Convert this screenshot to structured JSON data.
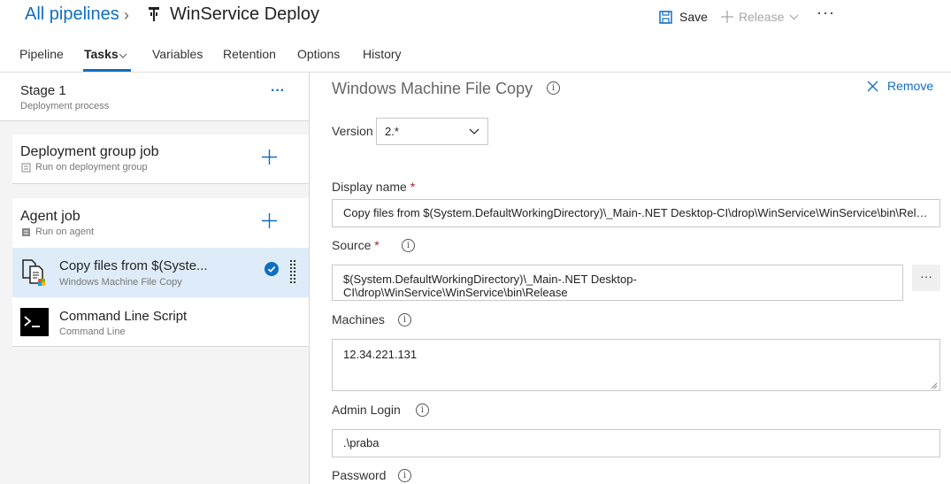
{
  "header": {
    "breadcrumb_root": "All pipelines",
    "separator": "›",
    "title": "WinService Deploy",
    "save_label": "Save",
    "release_label": "Release",
    "more_label": "···"
  },
  "tabs": [
    {
      "label": "Pipeline"
    },
    {
      "label": "Tasks",
      "active": true
    },
    {
      "label": "Variables"
    },
    {
      "label": "Retention"
    },
    {
      "label": "Options"
    },
    {
      "label": "History"
    }
  ],
  "stage": {
    "title": "Stage 1",
    "subtitle": "Deployment process",
    "more": "···"
  },
  "jobs": [
    {
      "title": "Deployment group job",
      "subtitle": "Run on deployment group"
    },
    {
      "title": "Agent job",
      "subtitle": "Run on agent"
    }
  ],
  "tasks": [
    {
      "title": "Copy files from $(Syste...",
      "subtitle": "Windows Machine File Copy",
      "selected": true
    },
    {
      "title": "Command Line Script",
      "subtitle": "Command Line"
    }
  ],
  "detail": {
    "task_title": "Windows Machine File Copy",
    "remove_label": "Remove",
    "version_label": "Version",
    "version_value": "2.*",
    "display_name_label": "Display name",
    "display_name_value": "Copy files from $(System.DefaultWorkingDirectory)\\_Main-.NET Desktop-CI\\drop\\WinService\\WinService\\bin\\Release",
    "source_label": "Source",
    "source_line1": "$(System.DefaultWorkingDirectory)\\_Main-.NET Desktop-",
    "source_line2": "CI\\drop\\WinService\\WinService\\bin\\Release",
    "source_more": "···",
    "machines_label": "Machines",
    "machines_value": "12.34.221.131",
    "admin_login_label": "Admin Login",
    "admin_login_value": ".\\praba",
    "password_label": "Password",
    "required_mark": "*",
    "info_glyph": "i"
  },
  "colors": {
    "accent": "#106ebe",
    "selected_row": "#deecf9",
    "required": "#a4262c"
  }
}
